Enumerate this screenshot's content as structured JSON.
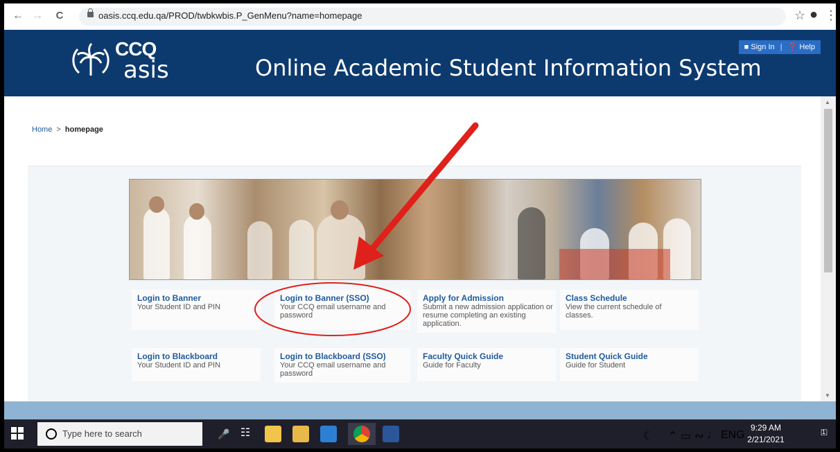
{
  "browser": {
    "url": "oasis.ccq.edu.qa/PROD/twbkwbis.P_GenMenu?name=homepage",
    "back_glyph": "←",
    "forward_glyph": "→",
    "reload_glyph": "C",
    "star_glyph": "☆",
    "profile_glyph": "●",
    "menu_glyph": "⋮"
  },
  "header": {
    "logo_top": "CCQ",
    "logo_bottom": "asis",
    "title": "Online Academic Student Information System",
    "sign_in": "Sign In",
    "help": "Help"
  },
  "breadcrumb": {
    "home": "Home",
    "sep": ">",
    "current": "homepage"
  },
  "tiles": [
    {
      "title": "Login to Banner",
      "desc": "Your Student ID and PIN"
    },
    {
      "title": "Login to Banner (SSO)",
      "desc": "Your CCQ email username and password"
    },
    {
      "title": "Apply for Admission",
      "desc": "Submit a new admission application or resume completing an existing application."
    },
    {
      "title": "Class Schedule",
      "desc": "View the current schedule of classes."
    },
    {
      "title": "Login to Blackboard",
      "desc": "Your Student ID and PIN"
    },
    {
      "title": "Login to Blackboard (SSO)",
      "desc": "Your CCQ email username and password"
    },
    {
      "title": "Faculty Quick Guide",
      "desc": "Guide for Faculty"
    },
    {
      "title": "Student Quick Guide",
      "desc": "Guide for Student"
    }
  ],
  "taskbar": {
    "search_placeholder": "Type here to search",
    "language": "ENG",
    "time": "9:29 AM",
    "date": "2/21/2021",
    "notify_count": "1"
  },
  "colors": {
    "header_bg": "#0d3a6e",
    "link_blue": "#1f5a9e",
    "annotation_red": "#e0201b"
  }
}
